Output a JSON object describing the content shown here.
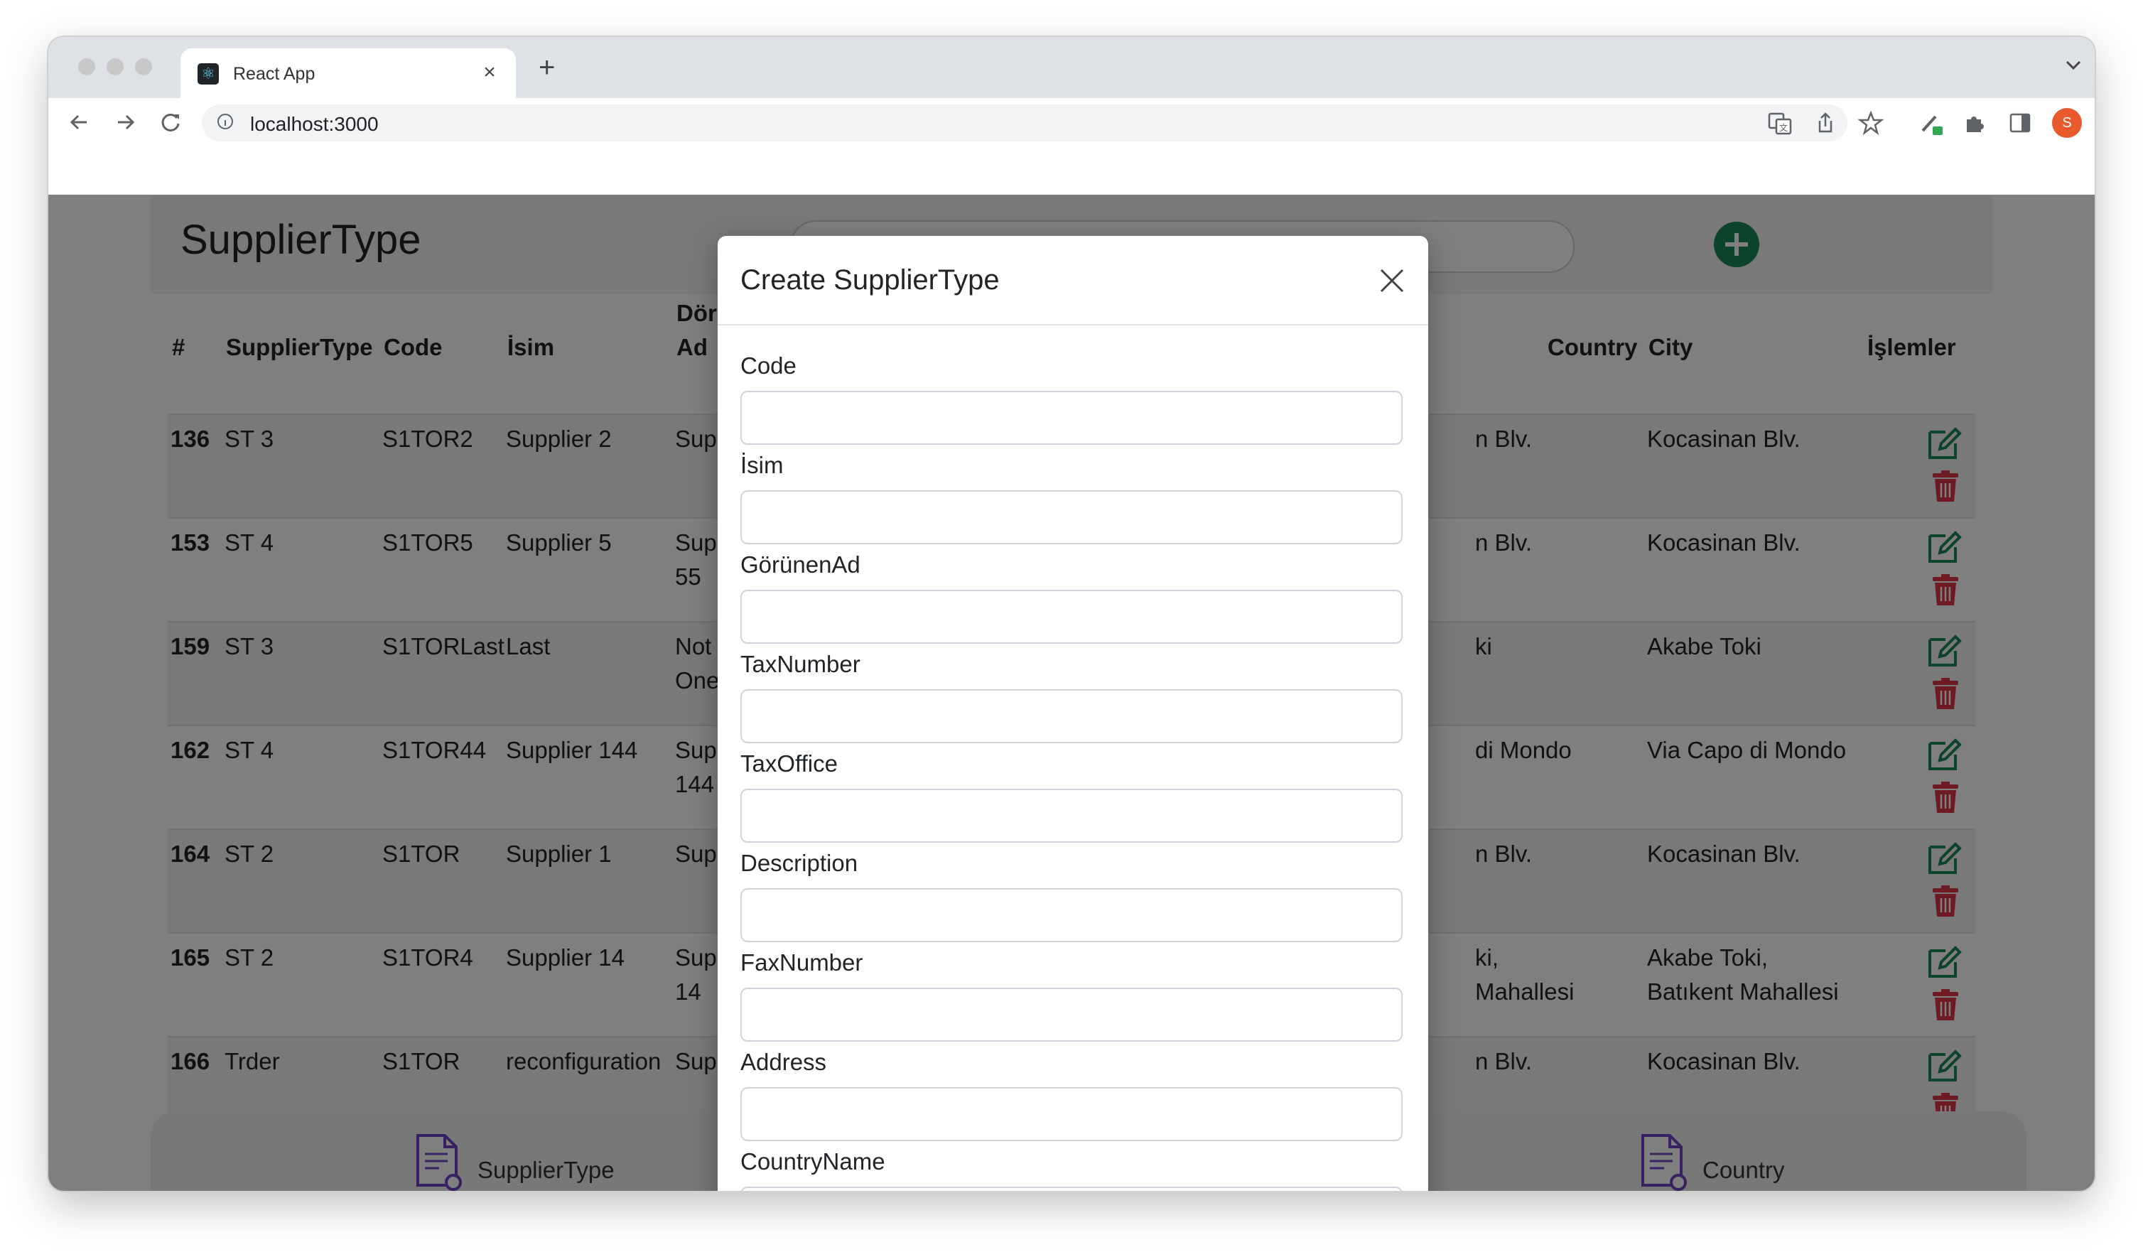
{
  "browser": {
    "tab_title": "React App",
    "tab_close": "×",
    "new_tab": "+",
    "url": "localhost:3000",
    "avatar_letter": "S"
  },
  "page": {
    "title": "SupplierType",
    "search": {
      "placeholder": "",
      "value": ""
    }
  },
  "table": {
    "headers": {
      "id": "#",
      "supplier_type": "SupplierType",
      "code": "Code",
      "name": "İsim",
      "display_name_1": "Dör",
      "display_name_2": "Ad",
      "country": "Country",
      "city": "City",
      "actions": "İşlemler"
    },
    "rows": [
      {
        "id": "136",
        "supplier_type": "ST 3",
        "code": "S1TOR2",
        "name": "Supplier 2",
        "display_1": "Sup",
        "display_2": "",
        "addr_1": "n Blv.",
        "addr_2": "",
        "city_1": "Kocasinan Blv.",
        "city_2": ""
      },
      {
        "id": "153",
        "supplier_type": "ST 4",
        "code": "S1TOR5",
        "name": "Supplier 5",
        "display_1": "Sup",
        "display_2": "55",
        "addr_1": "n Blv.",
        "addr_2": "",
        "city_1": "Kocasinan Blv.",
        "city_2": ""
      },
      {
        "id": "159",
        "supplier_type": "ST 3",
        "code": "S1TORLast",
        "name": "Last",
        "display_1": "Not",
        "display_2": "One",
        "addr_1": "ki",
        "addr_2": "",
        "city_1": "Akabe Toki",
        "city_2": ""
      },
      {
        "id": "162",
        "supplier_type": "ST 4",
        "code": "S1TOR44",
        "name": "Supplier 144",
        "display_1": "Sup",
        "display_2": "144",
        "addr_1": " di Mondo",
        "addr_2": "",
        "city_1": "Via Capo di Mondo",
        "city_2": ""
      },
      {
        "id": "164",
        "supplier_type": "ST 2",
        "code": "S1TOR",
        "name": "Supplier 1",
        "display_1": "Sup",
        "display_2": "",
        "addr_1": "n Blv.",
        "addr_2": "",
        "city_1": "Kocasinan Blv.",
        "city_2": ""
      },
      {
        "id": "165",
        "supplier_type": "ST 2",
        "code": "S1TOR4",
        "name": "Supplier 14",
        "display_1": "Sup",
        "display_2": "14",
        "addr_1": "ki,",
        "addr_2": "Mahallesi",
        "city_1": "Akabe Toki,",
        "city_2": "Batıkent Mahallesi"
      },
      {
        "id": "166",
        "supplier_type": "Trder",
        "code": "S1TOR",
        "name": "reconfiguration",
        "display_1": "Sup",
        "display_2": "",
        "addr_1": "n Blv.",
        "addr_2": "",
        "city_1": "Kocasinan Blv.",
        "city_2": ""
      }
    ]
  },
  "footer": {
    "left_label": "SupplierType",
    "right_label": "Country"
  },
  "modal": {
    "title": "Create SupplierType",
    "fields": [
      {
        "label": "Code",
        "value": ""
      },
      {
        "label": "İsim",
        "value": ""
      },
      {
        "label": "GörünenAd",
        "value": ""
      },
      {
        "label": "TaxNumber",
        "value": ""
      },
      {
        "label": "TaxOffice",
        "value": ""
      },
      {
        "label": "Description",
        "value": ""
      },
      {
        "label": "FaxNumber",
        "value": ""
      },
      {
        "label": "Address",
        "value": ""
      },
      {
        "label": "CountryName",
        "value": ""
      }
    ]
  },
  "colors": {
    "add_button": "#198754",
    "edit_icon": "#198754",
    "delete_icon": "#dc3545",
    "footer_icon": "#6f42c1"
  }
}
